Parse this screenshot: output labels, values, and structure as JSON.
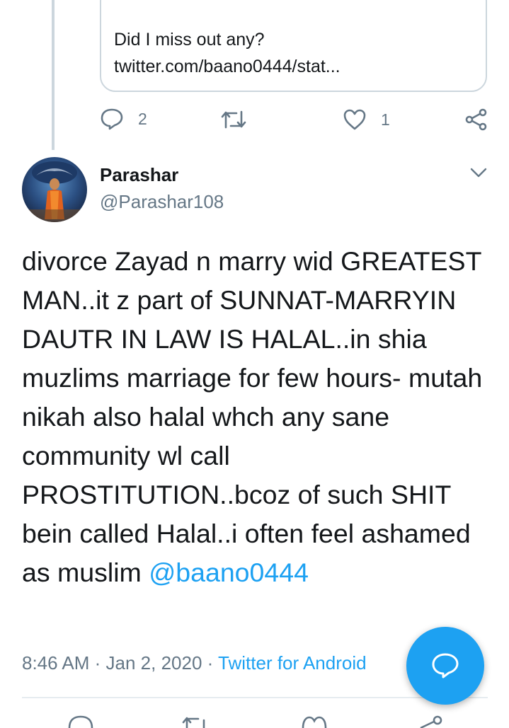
{
  "quoted_tweet": {
    "line1": "Did I miss out any?",
    "line2": "twitter.com/baano0444/stat..."
  },
  "previous_actions": {
    "reply_count": "2",
    "like_count": "1"
  },
  "tweet": {
    "author_name": "Parashar",
    "author_handle": "@Parashar108",
    "text": "divorce Zayad n marry wid GREATEST MAN..it z part of SUNNAT-MARRYIN DAUTR IN LAW IS HALAL..in shia muzlims marriage for few hours- mutah nikah also halal whch any sane community wl call PROSTITUTION..bcoz of such SHIT bein called Halal..i often feel ashamed as muslim ",
    "mention": "@baano0444",
    "time": "8:46 AM",
    "date": "Jan 2, 2020",
    "separator": " · ",
    "source": "Twitter for Android"
  },
  "icons": {
    "reply": "reply-icon",
    "retweet": "retweet-icon",
    "like": "heart-icon",
    "share": "share-icon",
    "more": "chevron-down-icon",
    "compose_reply": "speech-bubble-icon"
  },
  "colors": {
    "accent": "#1da1f2",
    "secondary_text": "#657786",
    "border": "#ccd6dd"
  }
}
